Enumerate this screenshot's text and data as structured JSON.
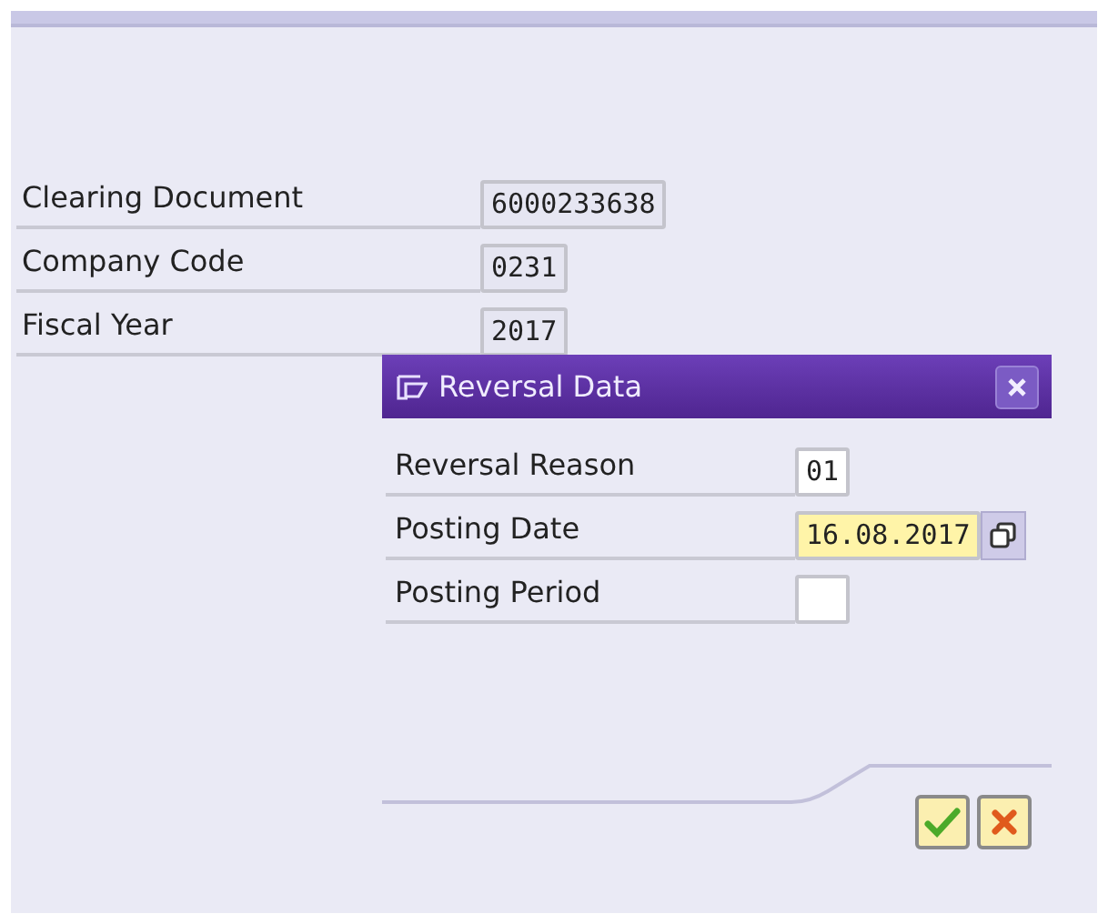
{
  "fields": [
    {
      "label": "Clearing Document",
      "value": "6000233638"
    },
    {
      "label": "Company Code",
      "value": "0231"
    },
    {
      "label": "Fiscal Year",
      "value": "2017"
    }
  ],
  "dialog": {
    "title": "Reversal Data",
    "fields": [
      {
        "label": "Reversal Reason",
        "value": "01",
        "focused": false,
        "value_help": false
      },
      {
        "label": "Posting Date",
        "value": "16.08.2017",
        "focused": true,
        "value_help": true
      },
      {
        "label": "Posting Period",
        "focused": false,
        "value_help": false
      }
    ]
  }
}
